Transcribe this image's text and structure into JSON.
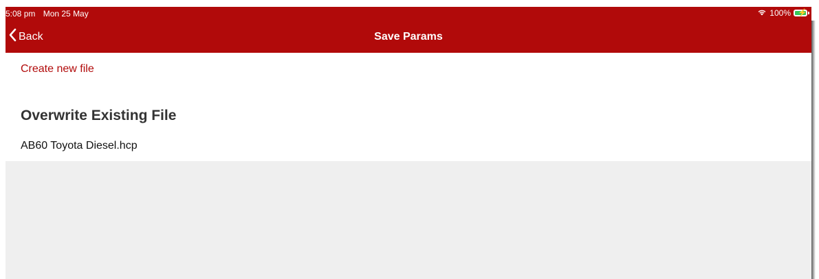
{
  "status_bar": {
    "time": "5:08 pm",
    "date": "Mon 25 May",
    "battery_percent": "100%",
    "battery_level": 1.0,
    "icons": [
      "wifi-icon",
      "battery-charging-icon"
    ]
  },
  "nav": {
    "back_label": "Back",
    "title": "Save Params"
  },
  "actions": {
    "create_new_label": "Create new file"
  },
  "overwrite_section": {
    "heading": "Overwrite Existing File",
    "files": [
      "AB60 Toyota Diesel.hcp"
    ]
  },
  "colors": {
    "accent": "#b10a0a",
    "background": "#efefef",
    "battery_fill": "#35c759"
  }
}
